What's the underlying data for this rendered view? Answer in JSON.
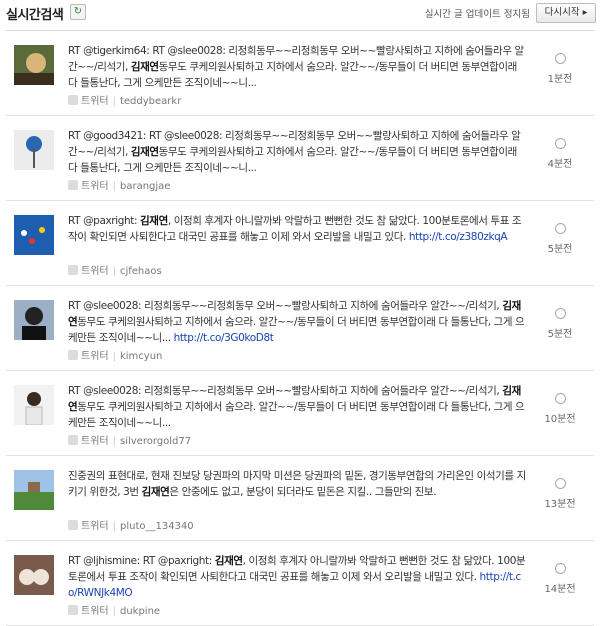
{
  "header": {
    "title": "실시간검색",
    "status_text": "실시간 글 업데이트 정지됨",
    "restart_label": "다시시작 ▸"
  },
  "items": [
    {
      "avatar": "avatar-photo",
      "text_segments": [
        {
          "t": "RT @tigerkim64: RT @slee0028: 리정희동무~~리정희동무 오버~~빨랑사퇴하고 지하에 숨어들라우 알간~~/리석기, "
        },
        {
          "t": "김재연",
          "bold": true
        },
        {
          "t": "동무도 쿠케의원사퇴하고 지하에서 숨으라. 알간~~/동무들이 더 버티면 동부연합이래 다 들통난다, 그게 으케만든 조직이네~~니..."
        }
      ],
      "source": "트위터",
      "user": "teddybearkr",
      "time": "1분전"
    },
    {
      "avatar": "avatar-photo",
      "text_segments": [
        {
          "t": "RT @good3421: RT @slee0028: 리정희동무~~리정희동무 오버~~빨랑사퇴하고 지하에 숨어들라우 알간~~/리석기, "
        },
        {
          "t": "김재연",
          "bold": true
        },
        {
          "t": "동무도 쿠케의원사퇴하고 지하에서 숨으라. 알간~~/동무들이 더 버티면 동부연합이래 다 들통난다, 그게 으케만든 조직이네~~니..."
        }
      ],
      "source": "트위터",
      "user": "barangjae",
      "time": "4분전"
    },
    {
      "avatar": "avatar-photo",
      "text_segments": [
        {
          "t": "RT @paxright: "
        },
        {
          "t": "김재연",
          "bold": true
        },
        {
          "t": ", 이정희 후계자 아니랄까봐 악랄하고 뻔뻔한 것도 참 닮았다. 100분토론에서 투표 조작이 확인되면 사퇴한다고 대국민 공표를 해놓고 이제 와서 오리발을 내밀고 있다. "
        },
        {
          "t": "http://t.co/z380zkqA",
          "link": true
        }
      ],
      "source": "트위터",
      "user": "cjfehaos",
      "time": "5분전"
    },
    {
      "avatar": "avatar-photo",
      "text_segments": [
        {
          "t": "RT @slee0028: 리정희동무~~리정희동무 오버~~빨랑사퇴하고 지하에 숨어들라우 알간~~/리석기, "
        },
        {
          "t": "김재연",
          "bold": true
        },
        {
          "t": "동무도 쿠케의원사퇴하고 지하에서 숨으라. 알간~~/동무들이 더 버티면 동부연합이래 다 들통난다, 그게 으케만든 조직이네~~니... "
        },
        {
          "t": "http://t.co/3G0koD8t",
          "link": true
        }
      ],
      "source": "트위터",
      "user": "kimcyun",
      "time": "5분전"
    },
    {
      "avatar": "avatar-photo",
      "text_segments": [
        {
          "t": "RT @slee0028: 리정희동무~~리정희동무 오버~~빨랑사퇴하고 지하에 숨어들라우 알간~~/리석기, "
        },
        {
          "t": "김재연",
          "bold": true
        },
        {
          "t": "동무도 쿠케의원사퇴하고 지하에서 숨으라. 알간~~/동무들이 더 버티면 동부연합이래 다 들통난다, 그게 으케만든 조직이네~~니..."
        }
      ],
      "source": "트위터",
      "user": "silverorgold77",
      "time": "10분전"
    },
    {
      "avatar": "avatar-photo",
      "text_segments": [
        {
          "t": "진중권의 표현대로, 현재 진보당 당권파의 마지막 미션은 당권파의 밑돈, 경기동부연합의 가리온인 이석기를 지키기 위한것, 3번 "
        },
        {
          "t": "김재연",
          "bold": true
        },
        {
          "t": "은 안중에도 없고, 분당이 되더라도 밑돈은 지킬.. 그들만의 진보."
        }
      ],
      "source": "트위터",
      "user": "pluto__134340",
      "time": "13분전"
    },
    {
      "avatar": "avatar-photo",
      "text_segments": [
        {
          "t": "RT @ljhismine: RT @paxright: "
        },
        {
          "t": "김재연",
          "bold": true
        },
        {
          "t": ", 이정희 후계자 아니랄까봐 악랄하고 뻔뻔한 것도 참 닮았다. 100분토론에서 투표 조작이 확인되면 사퇴한다고 대국민 공표를 해놓고 이제 와서 오리발을 내밀고 있다. "
        },
        {
          "t": "http://t.co/RWNJk4MO",
          "link": true
        }
      ],
      "source": "트위터",
      "user": "dukpine",
      "time": "14분전"
    }
  ]
}
